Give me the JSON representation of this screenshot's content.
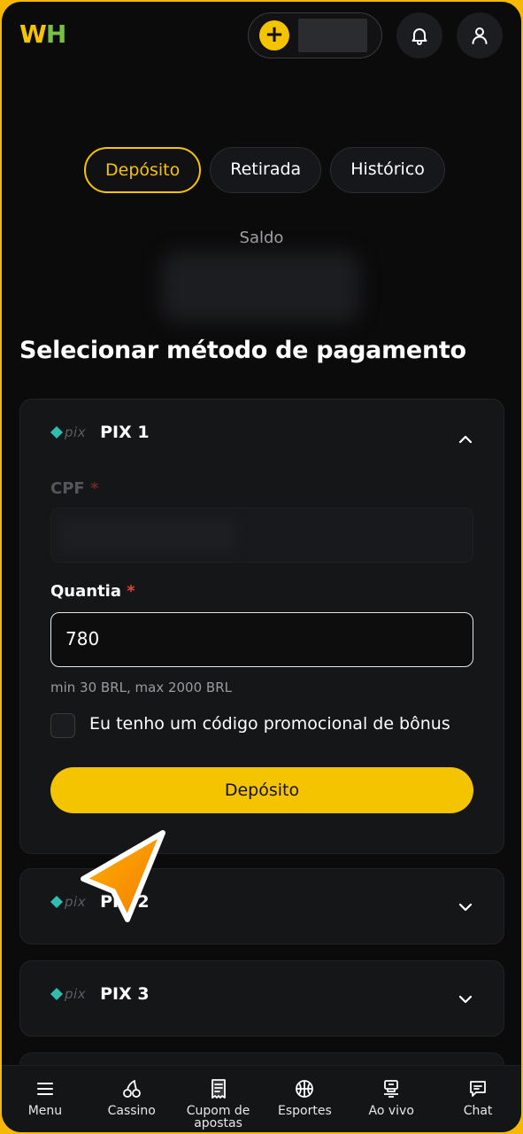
{
  "header": {
    "logo_w": "W",
    "logo_h": "H",
    "add_symbol": "+",
    "icons": [
      "plus-icon",
      "bell-icon",
      "user-icon"
    ]
  },
  "tabs": [
    {
      "label": "Depósito",
      "active": true
    },
    {
      "label": "Retirada",
      "active": false
    },
    {
      "label": "Histórico",
      "active": false
    }
  ],
  "balance": {
    "label": "Saldo"
  },
  "section_title": "Selecionar método de pagamento",
  "methods": [
    {
      "logo_text": "pix",
      "title": "PIX 1",
      "expanded": true,
      "cpf_label": "CPF",
      "amount_label": "Quantia",
      "required_mark": "*",
      "amount_value": "780",
      "limits_hint": "min 30 BRL, max 2000 BRL",
      "promo_checkbox_label": "Eu tenho um código promocional de bônus",
      "promo_checked": false,
      "submit_label": "Depósito"
    },
    {
      "logo_text": "pix",
      "title": "PIX 2",
      "expanded": false
    },
    {
      "logo_text": "pix",
      "title": "PIX 3",
      "expanded": false
    }
  ],
  "bottom_nav": [
    {
      "label": "Menu",
      "icon": "menu-icon"
    },
    {
      "label": "Cassino",
      "icon": "cherries-icon"
    },
    {
      "label": "Cupom de apostas",
      "icon": "receipt-icon"
    },
    {
      "label": "Esportes",
      "icon": "basketball-icon"
    },
    {
      "label": "Ao vivo",
      "icon": "live-icon"
    },
    {
      "label": "Chat",
      "icon": "chat-icon"
    }
  ],
  "colors": {
    "accent": "#f5c400",
    "background": "#0b0b0c",
    "card": "#151618",
    "required": "#e0423f",
    "pix_teal": "#32bcad"
  }
}
